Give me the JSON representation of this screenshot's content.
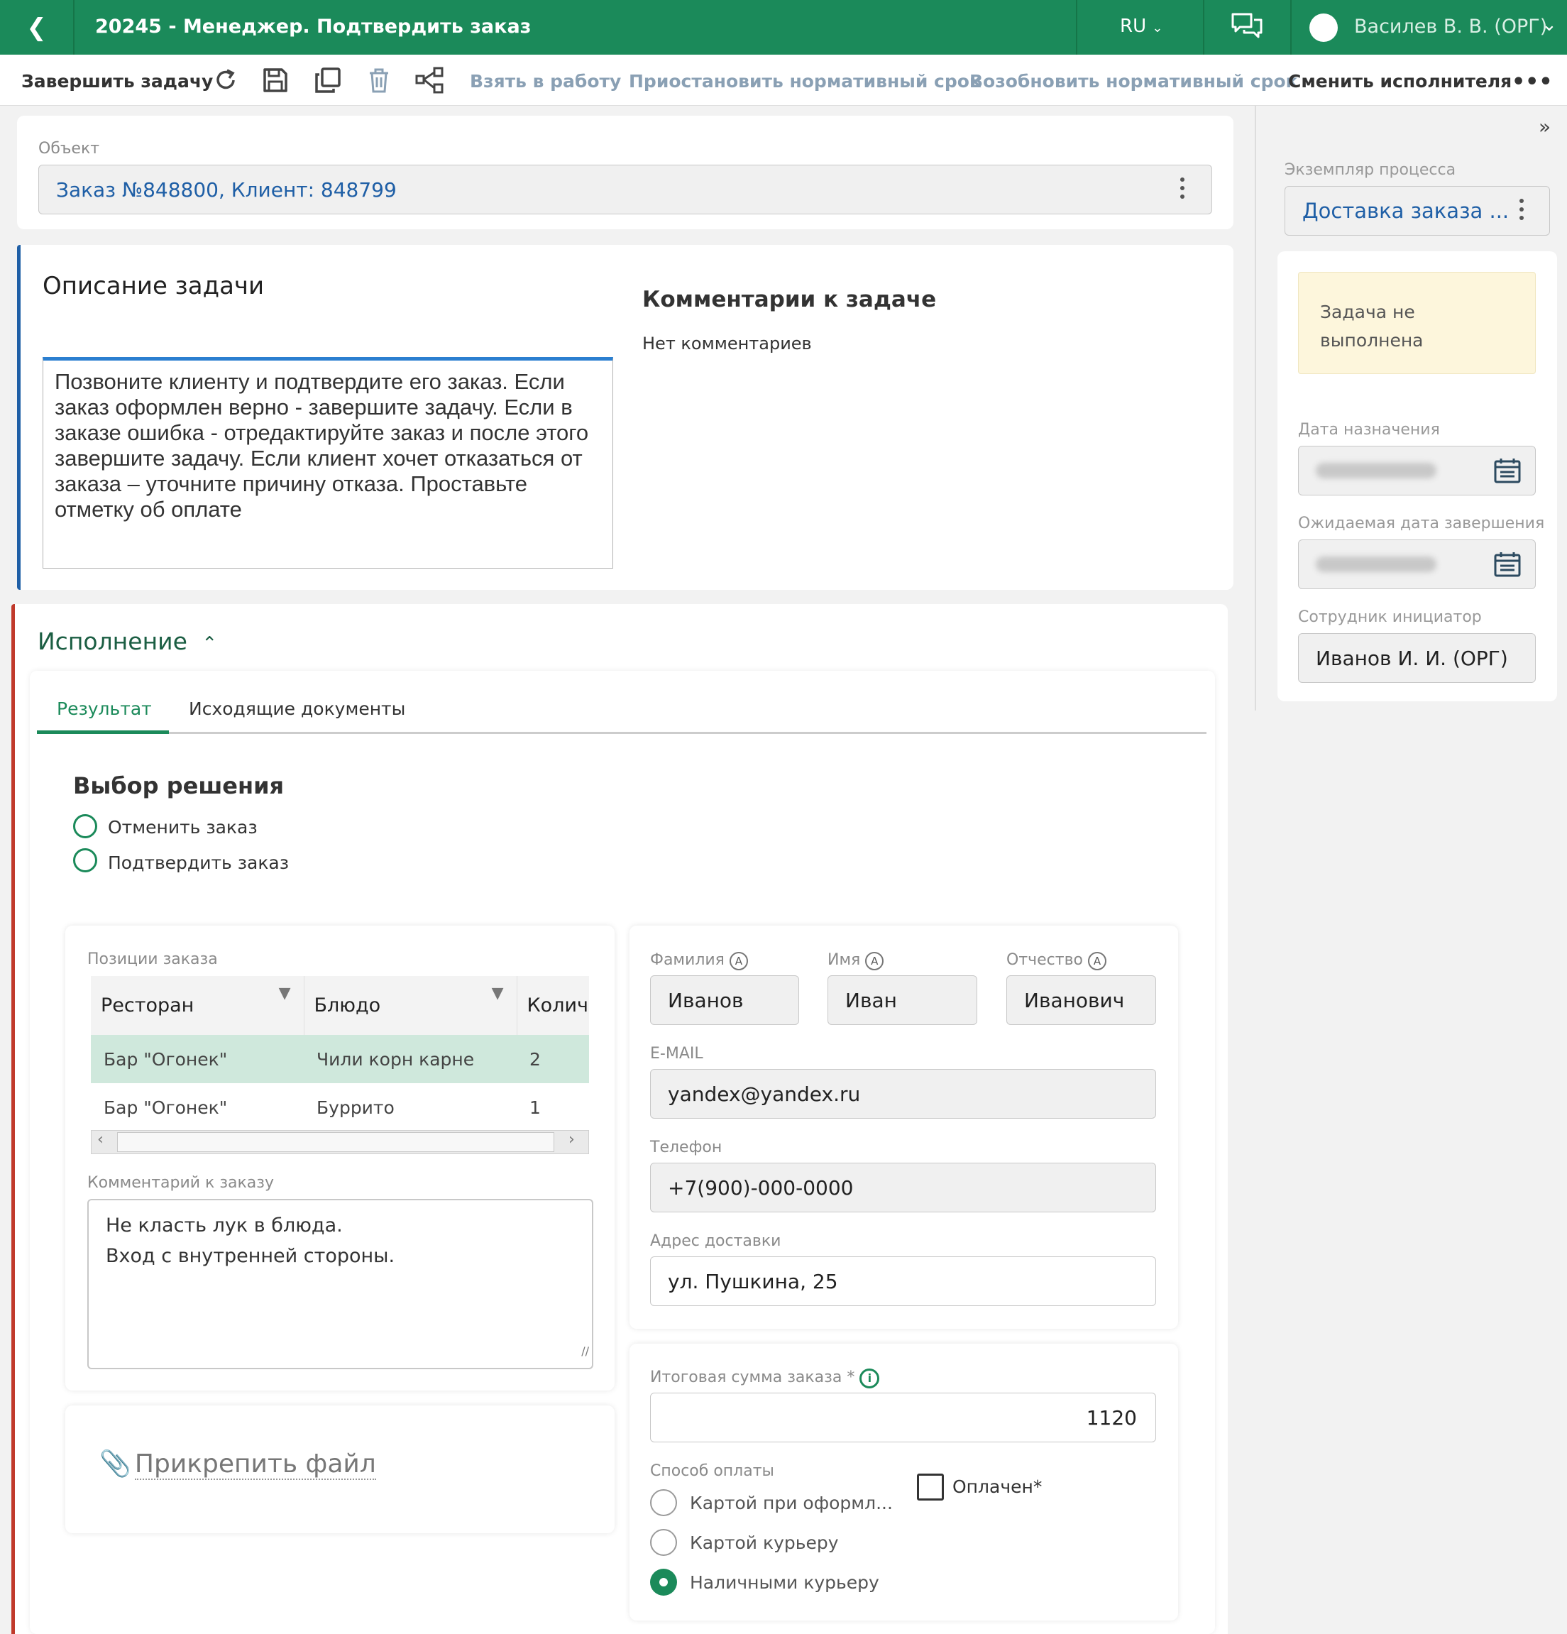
{
  "header": {
    "title": "20245 - Менеджер. Подтвердить заказ",
    "language": "RU",
    "user": "Василев В. В. (ОРГ)"
  },
  "toolbar": {
    "complete_task": "Завершить задачу",
    "take_to_work": "Взять в работу",
    "pause_deadline": "Приостановить нормативный срок",
    "resume_deadline": "Возобновить нормативный срок",
    "change_executor": "Сменить исполнителя"
  },
  "object": {
    "label": "Объект",
    "value": "Заказ №848800, Клиент: 848799"
  },
  "description": {
    "title": "Описание задачи",
    "text": "Позвоните клиенту и подтвердите его заказ. Если заказ оформлен верно - завершите задачу. Если в заказе ошибка - отредактируйте заказ и после этого завершите задачу. Если клиент хочет отказаться от заказа – уточните причину отказа. Проставьте отметку об оплате"
  },
  "comments": {
    "title": "Комментарии к задаче",
    "empty": "Нет комментариев"
  },
  "execution": {
    "title": "Исполнение",
    "tabs": [
      "Результат",
      "Исходящие документы"
    ],
    "decision_title": "Выбор решения",
    "decisions": [
      "Отменить заказ",
      "Подтвердить заказ"
    ]
  },
  "order_items": {
    "label": "Позиции заказа",
    "columns": [
      "Ресторан",
      "Блюдо",
      "Количе"
    ],
    "rows": [
      [
        "Бар \"Огонек\"",
        "Чили корн карне",
        "2"
      ],
      [
        "Бар \"Огонек\"",
        "Буррито",
        "1"
      ]
    ]
  },
  "order_comment": {
    "label": "Комментарий к заказу",
    "lines": [
      "Не класть лук в блюда.",
      "Вход с внутренней стороны."
    ]
  },
  "attach": {
    "label": "Прикрепить файл"
  },
  "client": {
    "last_name_label": "Фамилия",
    "last_name": "Иванов",
    "first_name_label": "Имя",
    "first_name": "Иван",
    "patronymic_label": "Отчество",
    "patronymic": "Иванович",
    "email_label": "E-MAIL",
    "email": "yandex@yandex.ru",
    "phone_label": "Телефон",
    "phone": "+7(900)-000-0000",
    "address_label": "Адрес доставки",
    "address": "ул. Пушкина, 25"
  },
  "payment": {
    "total_label": "Итоговая сумма заказа",
    "total_required": "*",
    "total": "1120",
    "method_label": "Способ оплаты",
    "methods": [
      "Картой при оформл...",
      "Картой курьеру",
      "Наличными курьеру"
    ],
    "selected_index": 2,
    "paid_label": "Оплачен*"
  },
  "side": {
    "process_label": "Экземпляр процесса",
    "process_value": "Доставка заказа ...",
    "status": "Задача не выполнена",
    "assigned_label": "Дата назначения",
    "expected_label": "Ожидаемая дата завершения",
    "initiator_label": "Сотрудник инициатор",
    "initiator": "Иванов И. И. (ОРГ)"
  }
}
